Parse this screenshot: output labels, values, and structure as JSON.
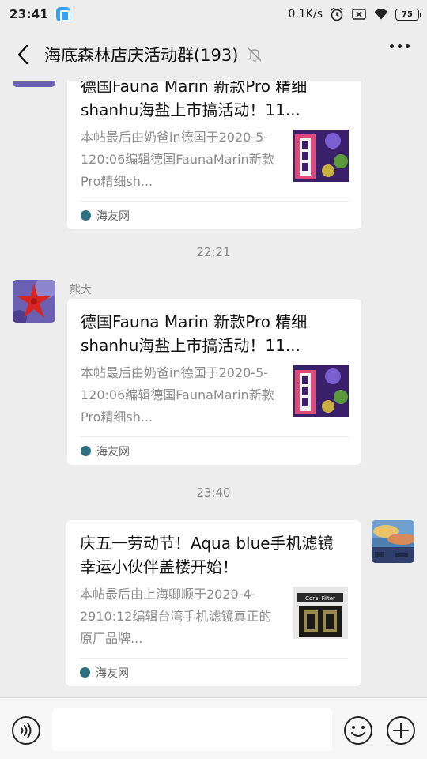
{
  "status_bar": {
    "time": "23:41",
    "network_speed": "0.1K/s",
    "battery": "75"
  },
  "header": {
    "title": "海底森林店庆活动群(193)",
    "icons": [
      "back-arrow-icon",
      "mute-bell-icon",
      "more-icon"
    ]
  },
  "messages": [
    {
      "card": {
        "title": "德国Fauna Marin 新款Pro 精细shanhu海盐上市搞活动！11...",
        "desc": "本帖最后由奶爸in德国于2020-5-120:06编辑德国FaunaMarin新款Pro精细sh...",
        "source": "海友网"
      }
    },
    {
      "time": "22:21",
      "sender": "熊大",
      "card": {
        "title": "德国Fauna Marin 新款Pro 精细shanhu海盐上市搞活动！11...",
        "desc": "本帖最后由奶爸in德国于2020-5-120:06编辑德国FaunaMarin新款Pro精细sh...",
        "source": "海友网"
      }
    },
    {
      "time": "23:40",
      "card": {
        "title": "庆五一劳动节！Aqua blue手机滤镜幸运小伙伴盖楼开始！",
        "desc": "本帖最后由上海卿顺于2020-4-2910:12编辑台湾手机滤镜真正的原厂品牌...",
        "source": "海友网",
        "thumb_text": "Coral Filter"
      }
    }
  ],
  "input_bar": {
    "placeholder": "",
    "icons": [
      "voice-icon",
      "emoji-icon",
      "plus-icon"
    ]
  },
  "colors": {
    "background": "#ededed",
    "card": "#ffffff",
    "muted_text": "#8c8c8c"
  }
}
